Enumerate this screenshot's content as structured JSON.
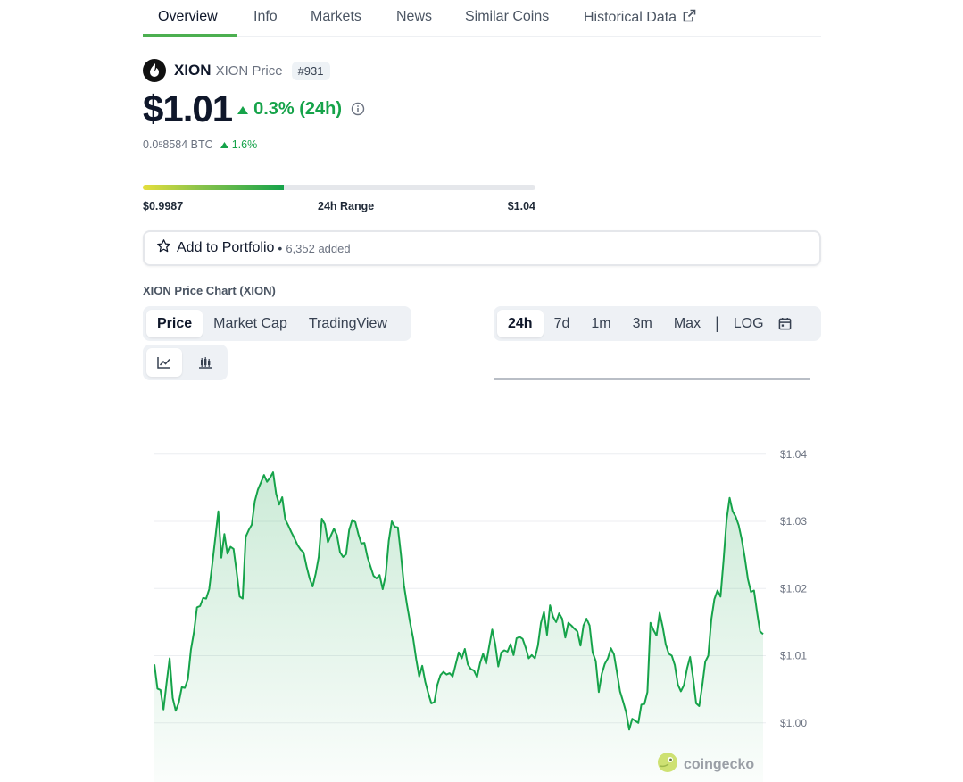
{
  "tabs": [
    {
      "label": "Overview"
    },
    {
      "label": "Info"
    },
    {
      "label": "Markets"
    },
    {
      "label": "News"
    },
    {
      "label": "Similar Coins"
    },
    {
      "label": "Historical Data"
    }
  ],
  "coin": {
    "symbol": "XION",
    "subtitle": "XION Price",
    "rank": "#931"
  },
  "price": {
    "value": "$1.01",
    "change": "0.3% (24h)",
    "btc_prefix": "0.0",
    "btc_sub": "5",
    "btc_rest": "8584 BTC",
    "btc_change": "1.6%",
    "up_color": "#16a34a"
  },
  "range": {
    "low": "$0.9987",
    "label": "24h Range",
    "high": "$1.04",
    "fill_fraction": 0.36
  },
  "portfolio": {
    "label": "Add to Portfolio",
    "separator": "•",
    "count": "6,352 added"
  },
  "chart_section": {
    "title": "XION Price Chart (XION)",
    "data_tabs": [
      "Price",
      "Market Cap",
      "TradingView"
    ],
    "range_tabs": [
      "24h",
      "7d",
      "1m",
      "3m",
      "Max"
    ],
    "separator": "|",
    "log_label": "LOG"
  },
  "brand": {
    "watermark": "coingecko"
  },
  "chart_data": {
    "type": "area",
    "y_ticks": [
      "$1.04",
      "$1.03",
      "$1.02",
      "$1.01",
      "$1.00"
    ],
    "ylim": [
      0.99,
      1.0425
    ],
    "grid": true,
    "color": "#16a34a",
    "values": [
      1.0087,
      1.0051,
      1.0049,
      1.002,
      1.0059,
      1.0096,
      1.0037,
      1.0018,
      1.003,
      1.0053,
      1.0052,
      1.0065,
      1.0109,
      1.0135,
      1.0172,
      1.0174,
      1.0186,
      1.0185,
      1.0199,
      1.0236,
      1.0275,
      1.0315,
      1.0246,
      1.0281,
      1.0252,
      1.0262,
      1.0259,
      1.0225,
      1.0188,
      1.0185,
      1.0277,
      1.0287,
      1.0295,
      1.033,
      1.0347,
      1.0358,
      1.0369,
      1.0359,
      1.0365,
      1.0373,
      1.0341,
      1.0325,
      1.0336,
      1.0303,
      1.0294,
      1.0284,
      1.0275,
      1.0265,
      1.0258,
      1.0254,
      1.0233,
      1.0215,
      1.0203,
      1.0222,
      1.0247,
      1.0304,
      1.0296,
      1.0269,
      1.0279,
      1.0289,
      1.0279,
      1.0254,
      1.0247,
      1.0251,
      1.0287,
      1.0302,
      1.0299,
      1.0281,
      1.0267,
      1.0268,
      1.0247,
      1.0233,
      1.0219,
      1.0215,
      1.022,
      1.0199,
      1.022,
      1.0271,
      1.03,
      1.0292,
      1.0291,
      1.0251,
      1.0205,
      1.0176,
      1.015,
      1.0126,
      1.0095,
      1.0069,
      1.0085,
      1.0061,
      1.0044,
      1.0029,
      1.0031,
      1.0057,
      1.0071,
      1.0076,
      1.0072,
      1.0074,
      1.0069,
      1.0087,
      1.0105,
      1.0096,
      1.011,
      1.0087,
      1.008,
      1.0078,
      1.0068,
      1.0089,
      1.0103,
      1.0088,
      1.0114,
      1.0139,
      1.0117,
      1.0084,
      1.0105,
      1.0108,
      1.0106,
      1.0117,
      1.0101,
      1.0126,
      1.0128,
      1.0125,
      1.0112,
      1.0096,
      1.0101,
      1.0096,
      1.0115,
      1.0149,
      1.0165,
      1.0131,
      1.0175,
      1.0158,
      1.015,
      1.0163,
      1.0155,
      1.0127,
      1.0149,
      1.0145,
      1.014,
      1.0136,
      1.0115,
      1.0145,
      1.0155,
      1.0145,
      1.0105,
      1.0092,
      1.0046,
      1.0073,
      1.0088,
      1.0096,
      1.0111,
      1.0102,
      1.0075,
      1.0047,
      1.0032,
      1.0016,
      0.999,
      1.0006,
      1.0003,
      1.0,
      1.0027,
      1.0028,
      1.0046,
      1.0149,
      1.0138,
      1.013,
      1.0164,
      1.0143,
      1.0117,
      1.0103,
      1.01,
      1.0086,
      1.0057,
      1.0047,
      1.0056,
      1.0081,
      1.0098,
      1.0067,
      1.0029,
      1.0025,
      1.0055,
      1.0091,
      1.01,
      1.0154,
      1.0184,
      1.0197,
      1.0188,
      1.0242,
      1.0302,
      1.0335,
      1.0315,
      1.0307,
      1.0294,
      1.0273,
      1.0246,
      1.0214,
      1.0195,
      1.0197,
      1.0165,
      1.0136,
      1.0132
    ]
  }
}
